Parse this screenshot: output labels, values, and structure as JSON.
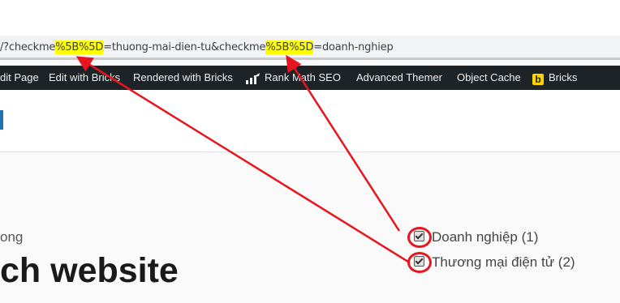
{
  "url": {
    "part1": "/?checkme",
    "hl1": "%5B%5D",
    "part2": "=thuong-mai-dien-tu&checkme",
    "hl2": "%5B%5D",
    "part3": "=doanh-nghiep"
  },
  "admin_bar": {
    "items": [
      "dit Page",
      "Edit with Bricks",
      "Rendered with Bricks",
      "Rank Math SEO",
      "Advanced Themer",
      "Object Cache",
      "Bricks"
    ],
    "rank_math_icon": "rank-math-icon",
    "bricks_logo": "b"
  },
  "content": {
    "breadcrumb": "ong",
    "title": "ch website"
  },
  "filters": [
    {
      "label": "Doanh nghiệp (1)",
      "checked": true
    },
    {
      "label": "Thương mại điện tử (2)",
      "checked": true
    }
  ],
  "annotation_color": "#e8141e",
  "highlight_color": "#ffff00"
}
